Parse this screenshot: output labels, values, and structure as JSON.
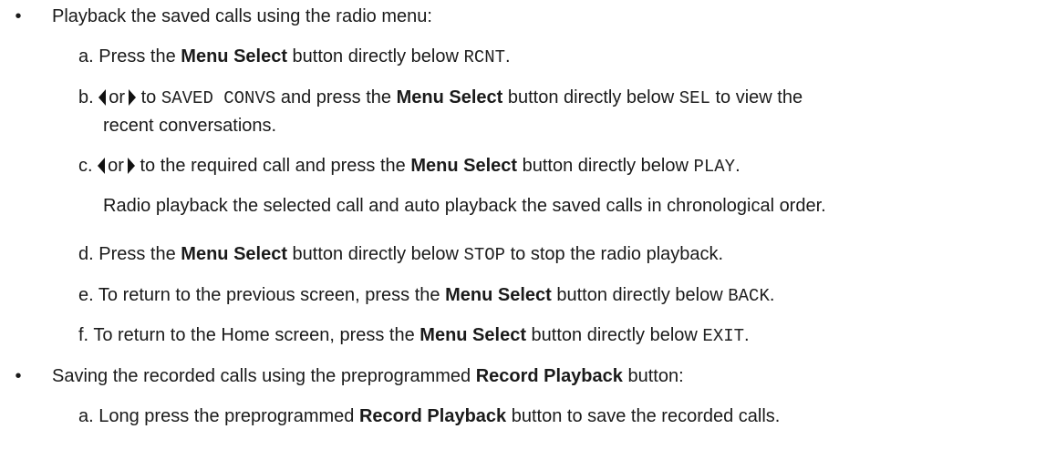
{
  "bullet_char": "•",
  "sections": [
    {
      "intro": "Playback the saved calls using the radio menu:",
      "steps": {
        "a": {
          "marker": "a.",
          "t1": "Press the ",
          "b1": "Menu Select",
          "t2": " button directly below ",
          "m1": "RCNT",
          "t3": "."
        },
        "b": {
          "marker": "b.",
          "t_or": "or",
          "t1": " to ",
          "m1": "SAVED CONVS",
          "t2": " and press the ",
          "b1": "Menu Select",
          "t3": " button directly below ",
          "m2": "SEL",
          "t4": " to view the",
          "cont": "recent conversations."
        },
        "c": {
          "marker": "c.",
          "t_or": "or",
          "t1": " to the required call and press the ",
          "b1": "Menu Select",
          "t2": " button directly below ",
          "m1": "PLAY",
          "t3": ".",
          "note": "Radio playback the selected call and auto playback the saved calls in chronological order."
        },
        "d": {
          "marker": "d.",
          "t1": "Press the ",
          "b1": "Menu Select",
          "t2": " button directly below ",
          "m1": "STOP",
          "t3": " to stop the radio playback."
        },
        "e": {
          "marker": "e.",
          "t1": "To return to the previous screen, press the ",
          "b1": "Menu Select",
          "t2": " button directly below ",
          "m1": "BACK",
          "t3": "."
        },
        "f": {
          "marker": "f.",
          "t1": "To return to the Home screen, press the ",
          "b1": "Menu Select",
          "t2": " button directly below ",
          "m1": "EXIT",
          "t3": "."
        }
      }
    },
    {
      "intro_t1": "Saving the recorded calls using the preprogrammed ",
      "intro_b1": "Record Playback",
      "intro_t2": " button:",
      "steps": {
        "a": {
          "marker": "a.",
          "t1": "Long press the preprogrammed ",
          "b1": "Record Playback",
          "t2": " button to save the recorded calls."
        }
      }
    }
  ]
}
